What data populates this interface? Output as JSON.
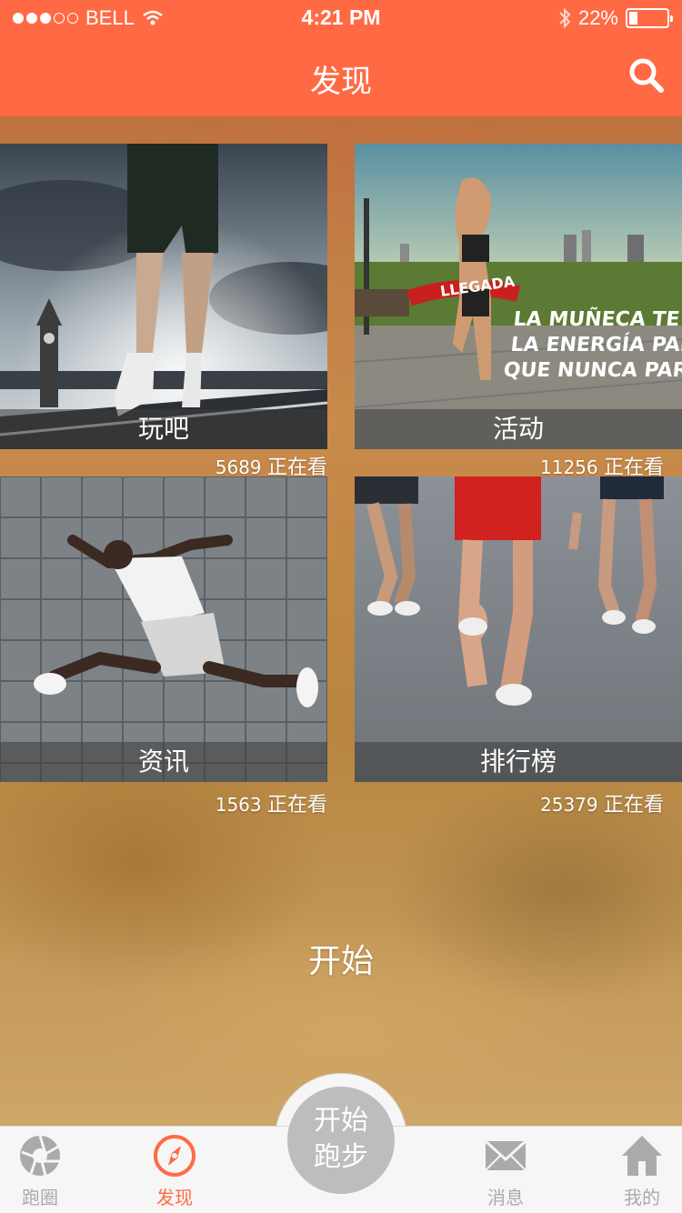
{
  "status_bar": {
    "carrier": "BELL",
    "time": "4:21 PM",
    "battery_text": "22%",
    "battery_level": 0.22
  },
  "nav": {
    "title": "发现"
  },
  "tiles": [
    {
      "label": "玩吧",
      "count": "5689",
      "suffix": "正在看"
    },
    {
      "label": "活动",
      "count": "11256",
      "suffix": "正在看",
      "poster_lines": [
        "LA MUÑECA TE DA",
        "LA ENERGÍA PARA",
        "QUE NUNCA PARES"
      ],
      "banner": "LLEGADA"
    },
    {
      "label": "资讯",
      "count": "1563",
      "suffix": "正在看"
    },
    {
      "label": "排行榜",
      "count": "25379",
      "suffix": "正在看"
    }
  ],
  "main": {
    "start_text": "开始"
  },
  "tab_bar": {
    "items": [
      {
        "label": "跑圈",
        "icon": "aperture-icon",
        "active": false
      },
      {
        "label": "发现",
        "icon": "compass-icon",
        "active": true
      },
      {
        "label": "消息",
        "icon": "mail-icon",
        "active": false
      },
      {
        "label": "我的",
        "icon": "home-icon",
        "active": false
      }
    ],
    "fab_line1": "开始",
    "fab_line2": "跑步"
  },
  "colors": {
    "accent": "#ff6a44",
    "tab_inactive": "#aaaaaa",
    "fab": "#bdbdbd"
  }
}
